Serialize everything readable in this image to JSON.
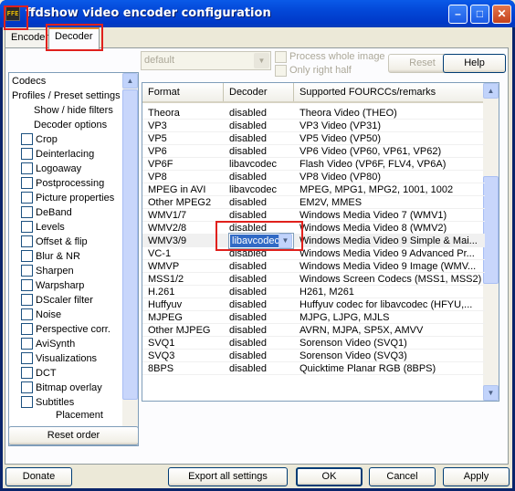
{
  "window": {
    "title": "ffdshow video encoder configuration",
    "app_icon_text": "FFE",
    "minimize_glyph": "–",
    "maximize_glyph": "□",
    "close_glyph": "✕"
  },
  "tabs": [
    {
      "label": "Encoder"
    },
    {
      "label": "Decoder"
    }
  ],
  "left_list": {
    "top_items": [
      "Codecs",
      "Profiles / Preset settings",
      "Show / hide filters",
      "Decoder options"
    ],
    "filters": [
      "Crop",
      "Deinterlacing",
      "Logoaway",
      "Postprocessing",
      "Picture properties",
      "DeBand",
      "Levels",
      "Offset & flip",
      "Blur & NR",
      "Sharpen",
      "Warpsharp",
      "DScaler filter",
      "Noise",
      "Perspective corr.",
      "AviSynth",
      "Visualizations",
      "DCT",
      "Bitmap overlay",
      "Subtitles"
    ],
    "partial_item": "Placement"
  },
  "reset_order_label": "Reset order",
  "preset": {
    "value": "default",
    "process_whole_image": "Process whole image",
    "only_right_half": "Only right half",
    "reset_label": "Reset",
    "help_label": "Help"
  },
  "grid": {
    "headers": [
      "Format",
      "Decoder",
      "Supported FOURCCs/remarks"
    ],
    "rows": [
      {
        "format": "Theora",
        "decoder": "disabled",
        "remarks": "Theora Video (THEO)"
      },
      {
        "format": "VP3",
        "decoder": "disabled",
        "remarks": "VP3 Video (VP31)"
      },
      {
        "format": "VP5",
        "decoder": "disabled",
        "remarks": "VP5 Video (VP50)"
      },
      {
        "format": "VP6",
        "decoder": "disabled",
        "remarks": "VP6 Video (VP60, VP61, VP62)"
      },
      {
        "format": "VP6F",
        "decoder": "libavcodec",
        "remarks": "Flash Video (VP6F, FLV4, VP6A)"
      },
      {
        "format": "VP8",
        "decoder": "disabled",
        "remarks": "VP8 Video (VP80)"
      },
      {
        "format": "MPEG in AVI",
        "decoder": "libavcodec",
        "remarks": "MPEG, MPG1, MPG2, 1001, 1002"
      },
      {
        "format": "Other MPEG2",
        "decoder": "disabled",
        "remarks": "EM2V, MMES"
      },
      {
        "format": "WMV1/7",
        "decoder": "disabled",
        "remarks": "Windows Media Video 7 (WMV1)"
      },
      {
        "format": "WMV2/8",
        "decoder": "disabled",
        "remarks": "Windows Media Video 8 (WMV2)"
      },
      {
        "format": "WMV3/9",
        "decoder": "libavcodec",
        "remarks": "Windows Media Video 9 Simple & Mai..."
      },
      {
        "format": "VC-1",
        "decoder": "disabled",
        "remarks": "Windows Media Video 9 Advanced Pr..."
      },
      {
        "format": "WMVP",
        "decoder": "disabled",
        "remarks": "Windows Media Video 9 Image (WMV..."
      },
      {
        "format": "MSS1/2",
        "decoder": "disabled",
        "remarks": "Windows Screen Codecs (MSS1, MSS2)"
      },
      {
        "format": "H.261",
        "decoder": "disabled",
        "remarks": "H261, M261"
      },
      {
        "format": "Huffyuv",
        "decoder": "disabled",
        "remarks": "Huffyuv codec for libavcodec (HFYU,..."
      },
      {
        "format": "MJPEG",
        "decoder": "disabled",
        "remarks": "MJPG, LJPG, MJLS"
      },
      {
        "format": "Other MJPEG",
        "decoder": "disabled",
        "remarks": "AVRN, MJPA, SP5X, AMVV"
      },
      {
        "format": "SVQ1",
        "decoder": "disabled",
        "remarks": "Sorenson Video (SVQ1)"
      },
      {
        "format": "SVQ3",
        "decoder": "disabled",
        "remarks": "Sorenson Video (SVQ3)"
      },
      {
        "format": "8BPS",
        "decoder": "disabled",
        "remarks": "Quicktime Planar RGB (8BPS)"
      }
    ],
    "editing_value": "libavcodec"
  },
  "footer": {
    "donate": "Donate",
    "export": "Export all settings",
    "ok": "OK",
    "cancel": "Cancel",
    "apply": "Apply"
  },
  "colors": {
    "titlebar": "#0347D7",
    "highlight_box": "#E0201C",
    "selection": "#316AC5",
    "active_tab_accent": "#E68B2C"
  }
}
